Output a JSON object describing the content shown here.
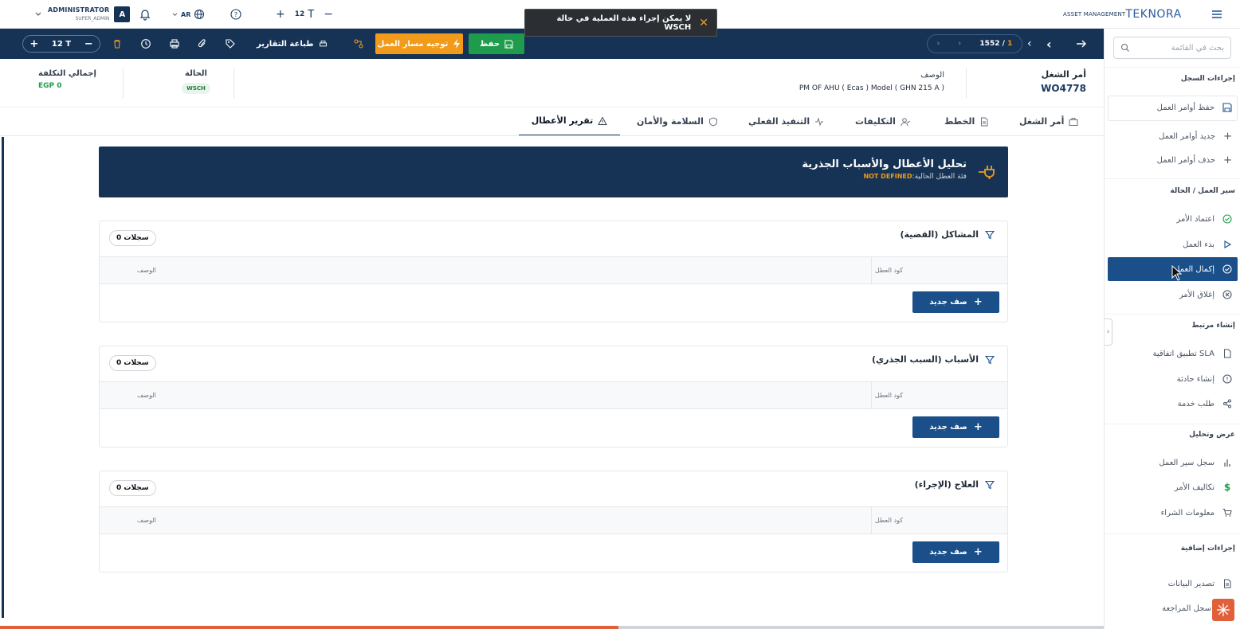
{
  "topbar": {
    "user_name": "ADMINISTRATOR",
    "user_role": "SUPER_ADMIN",
    "avatar_letter": "A",
    "lang": "AR",
    "font_size": "12",
    "brand_prefix": "ASSET MANAGEMENT",
    "brand_logo": "TEKNORA"
  },
  "toast": {
    "message": "لا يمكن إجراء هذه العملية في حالة WSCH"
  },
  "toolbar": {
    "zoom_value": "12",
    "print_reports": "طباعة التقارير",
    "route_work": "توجيه مسار العمل",
    "save": "حفظ",
    "pager_current": "1552",
    "pager_sep": "/",
    "pager_total": "1"
  },
  "header": {
    "wo_label": "أمر الشغل",
    "wo_value": "WO4778",
    "desc_label": "الوصف",
    "desc_value": "PM OF AHU  ( Ecas ) Model ( GHN 215 A )",
    "status_label": "الحالة",
    "status_value": "WSCH",
    "cost_label": "إجمالي التكلفة",
    "cost_value": "EGP 0"
  },
  "tabs": [
    {
      "label": "أمر الشغل"
    },
    {
      "label": "الخطط"
    },
    {
      "label": "التكليفات"
    },
    {
      "label": "التنفيذ الفعلي"
    },
    {
      "label": "السلامة والأمان"
    },
    {
      "label": "تقرير الأعطال"
    }
  ],
  "banner": {
    "title": "تحليل الأعطال والأسباب الجذرية",
    "subtitle": "فئة العطل الحالية:",
    "category": "NOT DEFINED"
  },
  "sections": [
    {
      "title": "المشاكل (القضية)",
      "count": "0 سجلات",
      "col_code": "كود العطل",
      "col_desc": "الوصف",
      "add": "صف جديد"
    },
    {
      "title": "الأسباب (السبب الجذري)",
      "count": "0 سجلات",
      "col_code": "كود العطل",
      "col_desc": "الوصف",
      "add": "صف جديد"
    },
    {
      "title": "العلاج (الإجراء)",
      "count": "0 سجلات",
      "col_code": "كود العطل",
      "col_desc": "الوصف",
      "add": "صف جديد"
    }
  ],
  "sidebar": {
    "search_placeholder": "بحث في القائمة",
    "groups": [
      {
        "title": "إجراءات السجل",
        "items": [
          "حفظ أوامر العمل",
          "جديد أوامر العمل",
          "حذف أوامر العمل"
        ]
      },
      {
        "title": "سير العمل / الحالة",
        "items": [
          "اعتماد الأمر",
          "بدء العمل",
          "إكمال العمل",
          "إغلاق الأمر"
        ]
      },
      {
        "title": "إنشاء مرتبط",
        "items": [
          "تطبيق اتفاقية SLA",
          "إنشاء حادثة",
          "طلب خدمة"
        ]
      },
      {
        "title": "عرض وتحليل",
        "items": [
          "سجل سير العمل",
          "تكاليف الأمر",
          "معلومات الشراء"
        ]
      },
      {
        "title": "إجراءات إضافية",
        "items": [
          "تصدير البيانات",
          "سجل المراجعة"
        ]
      }
    ]
  },
  "colors": {
    "navy": "#163356",
    "accent_blue": "#1b4f8a",
    "save_green": "#1f9c4b",
    "route_orange": "#f29a1a",
    "warning_orange": "#f29a1a"
  }
}
